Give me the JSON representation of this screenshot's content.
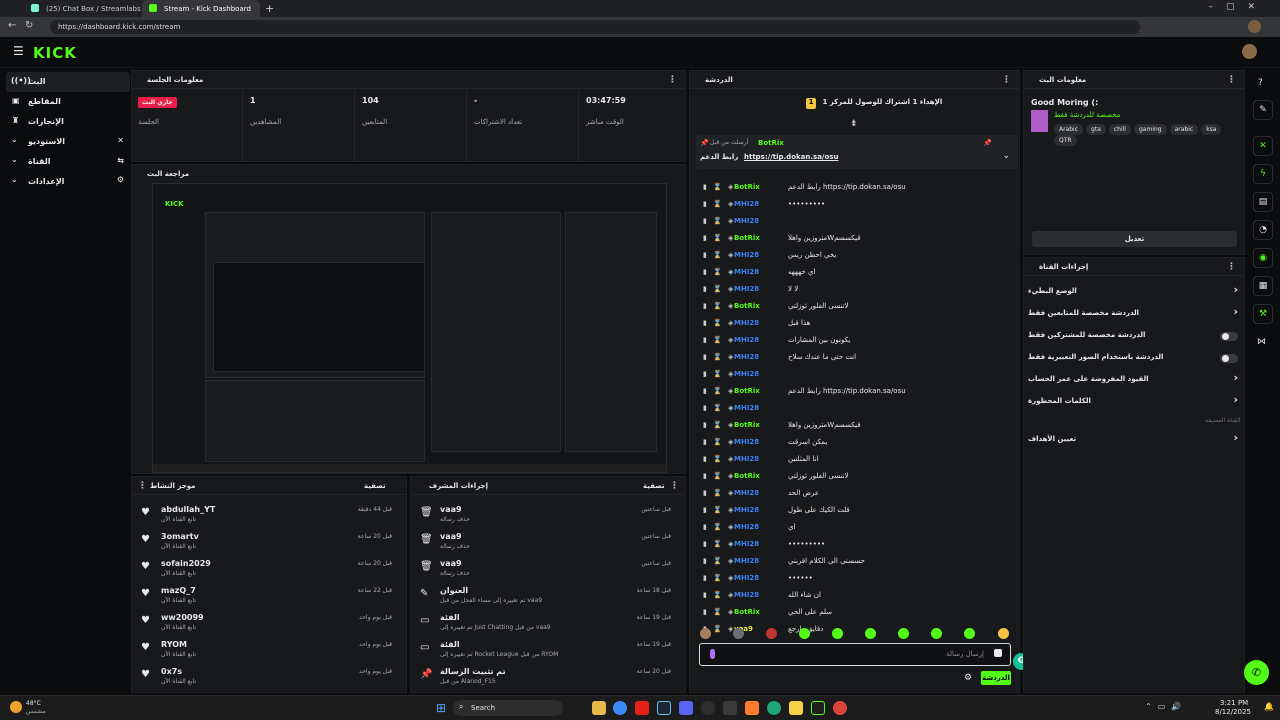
{
  "browser": {
    "tabs": [
      {
        "label": "(25) Chat Box / Streamlabs"
      },
      {
        "label": "Stream - Kick Dashboard"
      }
    ],
    "url": "https://dashboard.kick.com/stream"
  },
  "brand": {
    "logo": "KICK",
    "accent": "#53fc18"
  },
  "sidebar": {
    "items": [
      {
        "label": "البث",
        "icon": "broadcast-icon"
      },
      {
        "label": "المقاطع",
        "icon": "clips-icon"
      },
      {
        "label": "الإنجازات",
        "icon": "trophy-icon"
      },
      {
        "label": "الاستوديو",
        "icon": "studio-icon"
      },
      {
        "label": "القناة",
        "icon": "channel-icon"
      },
      {
        "label": "الإعدادات",
        "icon": "settings-icon"
      }
    ]
  },
  "session": {
    "title": "معلومات الجلسة",
    "live_badge": "جاري البث",
    "session_label": "الجلسة",
    "stats": [
      {
        "value": "1",
        "label": "المشاهدين"
      },
      {
        "value": "104",
        "label": "المتابعين"
      },
      {
        "value": "-",
        "label": "تعداد الاشتراكات"
      },
      {
        "value": "03:47:59",
        "label": "الوقت مباشر"
      }
    ]
  },
  "preview": {
    "title": "مراجعة البث"
  },
  "activity": {
    "title": "موجز النشاط",
    "filter": "تصفية",
    "items": [
      {
        "name": "abdullah_YT",
        "sub": "تابع القناة الآن",
        "time": "قبل 44 دقيقة"
      },
      {
        "name": "3omartv",
        "sub": "تابع القناة الآن",
        "time": "قبل 20 ساعة"
      },
      {
        "name": "sofain2029",
        "sub": "تابع القناة الآن",
        "time": "قبل 20 ساعة"
      },
      {
        "name": "mazQ_7",
        "sub": "تابع القناة الآن",
        "time": "قبل 22 ساعة"
      },
      {
        "name": "ww20099",
        "sub": "تابع القناة الآن",
        "time": "قبل يوم واحد"
      },
      {
        "name": "RYOM",
        "sub": "تابع القناة الآن",
        "time": "قبل يوم واحد"
      },
      {
        "name": "0x7s",
        "sub": "تابع القناة الآن",
        "time": "قبل يوم واحد"
      }
    ]
  },
  "modlog": {
    "title": "إجراءات المشرف",
    "filter": "تصفية",
    "items": [
      {
        "name": "vaa9",
        "sub": "حذف رسالة",
        "time": "قبل ساعتين"
      },
      {
        "name": "vaa9",
        "sub": "حذف رسالة",
        "time": "قبل ساعتين"
      },
      {
        "name": "vaa9",
        "sub": "حذف رسالة",
        "time": "قبل ساعتين"
      },
      {
        "name": "العنوان",
        "sub": "تم تغييره إلى مساء الفحل من قبل vaa9",
        "time": "قبل 18 ساعة"
      },
      {
        "name": "الفئة",
        "sub": "تم تغييره إلى Just Chatting من قبل vaa9",
        "time": "قبل 19 ساعة"
      },
      {
        "name": "الفئة",
        "sub": "تم تغييره إلى Rocket League من قبل RYOM",
        "time": "قبل 19 ساعة"
      },
      {
        "name": "تم تثبيت الرسالة",
        "sub": "من قبل Alanod_F15",
        "time": "قبل 20 ساعة"
      }
    ]
  },
  "chat": {
    "title": "الدردشة",
    "goal": "الإهداء 1 اشتراك للوصول للمركز 1",
    "pinned_by": "أرسلت من قبل",
    "pinned_user": "BotRix",
    "pinned_label": "رابط الدعم",
    "pinned_link": "https://tip.dokan.sa/osu",
    "messages": [
      {
        "user": "BotRix",
        "text": "رابط الدعم https://tip.dokan.sa/osu",
        "color": "#53fc18"
      },
      {
        "user": "MHI28",
        "text": "•••••••••",
        "color": "#3b82f6"
      },
      {
        "user": "MHI28",
        "text": "",
        "color": "#3b82f6"
      },
      {
        "user": "BotRix",
        "text": "متروزين واهلاWقيكسسم",
        "color": "#53fc18"
      },
      {
        "user": "MHI28",
        "text": "يخي احطن ريس",
        "color": "#3b82f6"
      },
      {
        "user": "MHI28",
        "text": "اي خهههه",
        "color": "#3b82f6"
      },
      {
        "user": "MHI28",
        "text": "لا لا",
        "color": "#3b82f6"
      },
      {
        "user": "BotRix",
        "text": "لاتنسى الفلور ئوزلتي",
        "color": "#53fc18"
      },
      {
        "user": "MHI28",
        "text": "هذا قبل",
        "color": "#3b82f6"
      },
      {
        "user": "MHI28",
        "text": "يكونون بين المشارات",
        "color": "#3b82f6"
      },
      {
        "user": "MHI28",
        "text": "انت حتى ما عندك سلاح",
        "color": "#3b82f6"
      },
      {
        "user": "MHI28",
        "text": "",
        "color": "#3b82f6"
      },
      {
        "user": "BotRix",
        "text": "رابط الدعم https://tip.dokan.sa/osu",
        "color": "#53fc18"
      },
      {
        "user": "MHI28",
        "text": "",
        "color": "#3b82f6"
      },
      {
        "user": "BotRix",
        "text": "متروزين واهلاWقيكسسم",
        "color": "#53fc18"
      },
      {
        "user": "MHI28",
        "text": "يمكن اسرقت",
        "color": "#3b82f6"
      },
      {
        "user": "MHI28",
        "text": "انا المثلتين",
        "color": "#3b82f6"
      },
      {
        "user": "BotRix",
        "text": "لاتنسى الفلور ئوزلتي",
        "color": "#53fc18"
      },
      {
        "user": "MHI28",
        "text": "عرض الحد",
        "color": "#3b82f6"
      },
      {
        "user": "MHI28",
        "text": "قلت الكيك على طول",
        "color": "#3b82f6"
      },
      {
        "user": "MHI28",
        "text": "اي",
        "color": "#3b82f6"
      },
      {
        "user": "MHI28",
        "text": "•••••••••",
        "color": "#3b82f6"
      },
      {
        "user": "MHI28",
        "text": "حسسني الي الكلام اقربني",
        "color": "#3b82f6"
      },
      {
        "user": "MHI28",
        "text": "••••••",
        "color": "#3b82f6"
      },
      {
        "user": "MHI28",
        "text": "ان شاء الله",
        "color": "#3b82f6"
      },
      {
        "user": "BotRix",
        "text": "سلم على الحي",
        "color": "#53fc18"
      },
      {
        "user": "vaa9",
        "text": "دقايق وارجع",
        "color": "#e4e645"
      }
    ],
    "input_placeholder": "إرسال رسالة",
    "send_label": "الدردشة"
  },
  "streaminfo": {
    "title": "معلومات البث",
    "stream_title": "Good Moring (:",
    "category": "مخصصة للدردشة فقط",
    "tags": [
      "Arabic",
      "gta",
      "chill",
      "gaming",
      "arabic",
      "ksa",
      "QTR"
    ],
    "edit_label": "تعديل"
  },
  "channel_actions": {
    "title": "إجراءات القناة",
    "rows": [
      {
        "label": "الوضع البطيء",
        "kind": "chevron"
      },
      {
        "label": "الدردشة مخصصة للمتابعين فقط",
        "kind": "chevron"
      },
      {
        "label": "الدردشة مخصصة للمشتركين فقط",
        "kind": "toggle"
      },
      {
        "label": "الدردشة باستخدام الصور التعبيرية فقط",
        "kind": "toggle"
      },
      {
        "label": "القيود المفروضة على عمر الحساب",
        "kind": "chevron"
      },
      {
        "label": "الكلمات المحظورة",
        "kind": "chevron"
      }
    ],
    "section_label": "القناة المضيفة",
    "target_label": "تعيين الأهداف"
  },
  "taskbar": {
    "weather": "48°C",
    "weather_sub": "مشمس",
    "search": "Search",
    "time": "3:21 PM",
    "date": "8/12/2025"
  }
}
